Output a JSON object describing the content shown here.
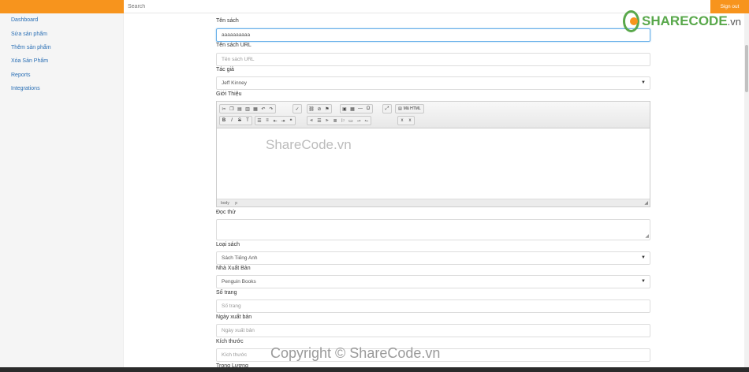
{
  "topbar": {
    "search_placeholder": "Search",
    "signout_label": "Sign out"
  },
  "sidebar": {
    "items": [
      {
        "label": "Dashboard"
      },
      {
        "label": "Sửa sản phẩm"
      },
      {
        "label": "Thêm sản phẩm"
      },
      {
        "label": "Xóa Sản Phẩm"
      },
      {
        "label": "Reports"
      },
      {
        "label": "Integrations"
      }
    ]
  },
  "form": {
    "ten_sach": {
      "label": "Tên sách",
      "value": "aaaaaaaaaa"
    },
    "ten_sach_url": {
      "label": "Tên sách URL",
      "placeholder": "Tên sách URL"
    },
    "tac_gia": {
      "label": "Tác giả",
      "selected": "Jeff Kinney"
    },
    "gioi_thieu": {
      "label": "Giới Thiệu"
    },
    "doc_thu": {
      "label": "Đọc thử"
    },
    "loai_sach": {
      "label": "Loại sách",
      "selected": "Sách Tiếng Anh"
    },
    "nha_xuat_ban": {
      "label": "Nhà Xuất Bản",
      "selected": "Penguin Books"
    },
    "so_trang": {
      "label": "Số trang",
      "placeholder": "Số trang"
    },
    "ngay_xuat_ban": {
      "label": "Ngày xuất bản",
      "placeholder": "Ngày xuất bản"
    },
    "kich_thuoc": {
      "label": "Kích thước",
      "placeholder": "Kích thước"
    },
    "trong_luong": {
      "label": "Trọng Lượng"
    }
  },
  "editor": {
    "source_label": "Mã HTML",
    "status_tags": [
      "body",
      "p"
    ]
  },
  "watermark": {
    "center": "ShareCode.vn",
    "bottom": "Copyright © ShareCode.vn"
  },
  "logo": {
    "name": "SHARECODE",
    "domain": ".vn"
  },
  "colors": {
    "accent": "#f7941d",
    "link": "#2a6fb5",
    "logo_green": "#59a84b"
  }
}
